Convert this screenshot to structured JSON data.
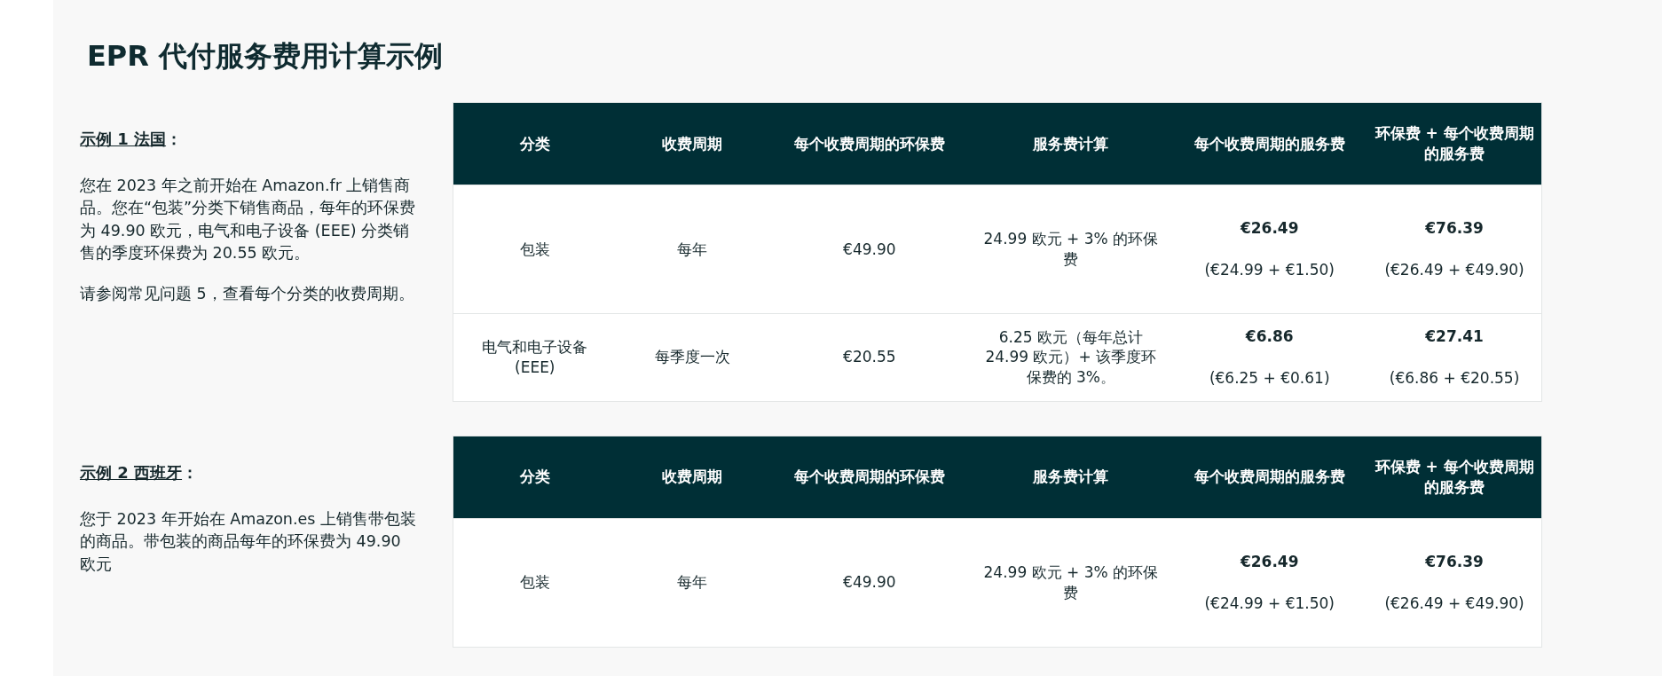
{
  "title": "EPR 代付服务费用计算示例",
  "examples": [
    {
      "heading": {
        "label": "示例 1 法国",
        "suffix": "："
      },
      "paragraphs": [
        "您在 2023 年之前开始在 Amazon.fr 上销售商品。您在“包装”分类下销售商品，每年的环保费为 49.90 欧元，电气和电子设备 (EEE) 分类销售的季度环保费为 20.55 欧元。",
        "请参阅常见问题 5，查看每个分类的收费周期。"
      ],
      "table": {
        "columns": [
          "分类",
          "收费周期",
          "每个收费周期的环保费",
          "服务费计算",
          "每个收费周期的服务费",
          "环保费 + 每个收费周期的服务费"
        ],
        "rows": [
          {
            "category": "包装",
            "cycle": "每年",
            "fee": "€49.90",
            "calc": "24.99 欧元 + 3% 的环保费",
            "service_fee": {
              "amount": "€26.49",
              "breakdown": "(€24.99 + €1.50)"
            },
            "total": {
              "amount": "€76.39",
              "breakdown": "(€26.49 + €49.90)"
            }
          },
          {
            "category": "电气和电子设备 (EEE)",
            "cycle": "每季度一次",
            "fee": "€20.55",
            "calc": "6.25 欧元（每年总计 24.99 欧元）+ 该季度环保费的 3%。",
            "service_fee": {
              "amount": "€6.86",
              "breakdown": "(€6.25 + €0.61)"
            },
            "total": {
              "amount": "€27.41",
              "breakdown": "(€6.86 + €20.55)"
            }
          }
        ]
      }
    },
    {
      "heading": {
        "label": "示例 2 西班牙",
        "suffix": "："
      },
      "paragraphs": [
        "您于 2023 年开始在 Amazon.es 上销售带包装的商品。带包装的商品每年的环保费为 49.90 欧元"
      ],
      "table": {
        "columns": [
          "分类",
          "收费周期",
          "每个收费周期的环保费",
          "服务费计算",
          "每个收费周期的服务费",
          "环保费 + 每个收费周期的服务费"
        ],
        "rows": [
          {
            "category": "包装",
            "cycle": "每年",
            "fee": "€49.90",
            "calc": "24.99 欧元 + 3% 的环保费",
            "service_fee": {
              "amount": "€26.49",
              "breakdown": "(€24.99 + €1.50)"
            },
            "total": {
              "amount": "€76.39",
              "breakdown": "(€26.49 + €49.90)"
            }
          }
        ]
      }
    }
  ]
}
